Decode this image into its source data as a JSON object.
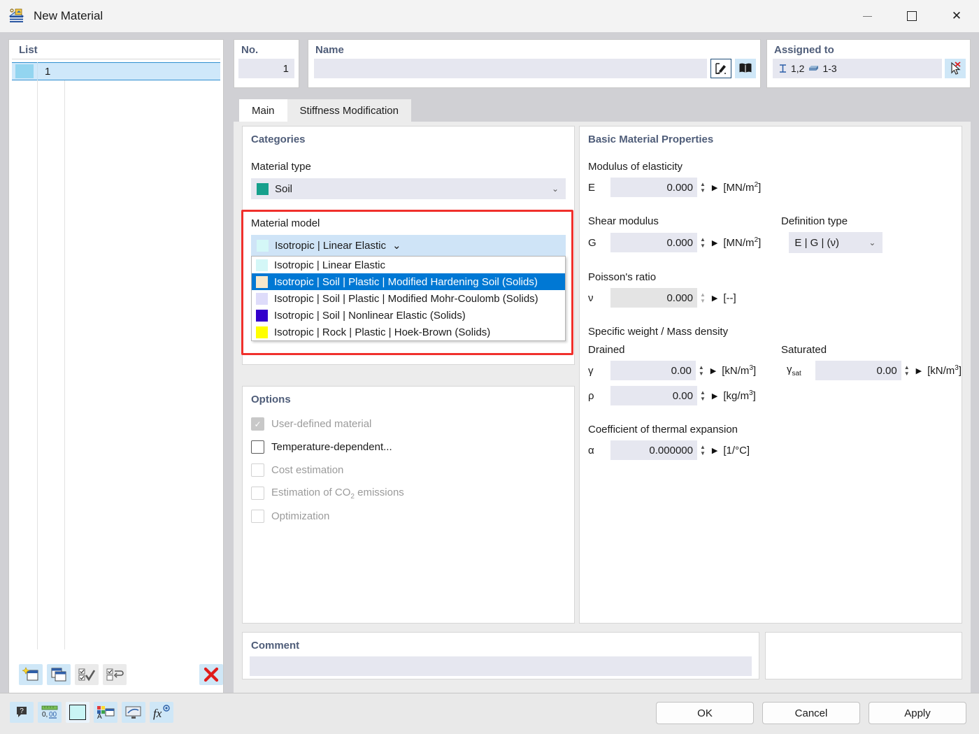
{
  "window": {
    "title": "New Material",
    "icon": "material-icon",
    "minimize": "minimize-icon",
    "maximize": "maximize-icon",
    "close": "close-icon"
  },
  "list": {
    "title": "List",
    "rows": [
      {
        "swatch": "#93d5f0",
        "no": "1",
        "name": ""
      }
    ],
    "toolbar": [
      {
        "name": "new-material-button",
        "icon": "new-window-star-icon"
      },
      {
        "name": "copy-material-button",
        "icon": "copy-window-icon"
      },
      {
        "name": "select-all-button",
        "icon": "check-all-icon"
      },
      {
        "name": "invert-selection-button",
        "icon": "invert-selection-icon"
      },
      {
        "name": "delete-material-button",
        "icon": "red-x-icon"
      }
    ]
  },
  "no": {
    "title": "No.",
    "value": "1"
  },
  "name": {
    "title": "Name",
    "value": "",
    "placeholder": "",
    "edit_icon": "edit-pencil-icon",
    "library_icon": "book-library-icon"
  },
  "assigned": {
    "title": "Assigned to",
    "members_icon": "i-beam-member-icon",
    "members": "1,2",
    "surfaces_icon": "solid-block-icon",
    "surfaces": "1-3",
    "pick_icon": "pick-cursor-icon"
  },
  "tabs": [
    {
      "label": "Main",
      "active": true
    },
    {
      "label": "Stiffness Modification",
      "active": false
    }
  ],
  "categories": {
    "title": "Categories",
    "material_type_label": "Material type",
    "material_type_value": "Soil",
    "material_type_color": "#17a08c",
    "material_model_label": "Material model",
    "material_model_value": "Isotropic | Linear Elastic",
    "material_model_color": "#d4f7f7",
    "material_model_options": [
      {
        "label": "Isotropic | Linear Elastic",
        "color": "#d4f7f7",
        "selected": false
      },
      {
        "label": "Isotropic | Soil | Plastic | Modified Hardening Soil (Solids)",
        "color": "#f7e8cb",
        "selected": true
      },
      {
        "label": "Isotropic | Soil | Plastic | Modified Mohr-Coulomb (Solids)",
        "color": "#dedcfa",
        "selected": false
      },
      {
        "label": "Isotropic | Soil | Nonlinear Elastic (Solids)",
        "color": "#3300cc",
        "selected": false
      },
      {
        "label": "Isotropic | Rock | Plastic | Hoek-Brown (Solids)",
        "color": "#ffff00",
        "selected": false
      }
    ]
  },
  "options": {
    "title": "Options",
    "items": [
      {
        "label": "User-defined material",
        "checked": true,
        "disabled": true
      },
      {
        "label": "Temperature-dependent...",
        "checked": false,
        "disabled": false
      },
      {
        "label": "Cost estimation",
        "checked": false,
        "disabled": true
      },
      {
        "label": "Estimation of CO2 emissions",
        "checked": false,
        "disabled": true
      },
      {
        "label": "Optimization",
        "checked": false,
        "disabled": true
      }
    ]
  },
  "properties": {
    "title": "Basic Material Properties",
    "modulus_group": "Modulus of elasticity",
    "modulus": {
      "symbol": "E",
      "value": "0.000",
      "unit": "MN/m2"
    },
    "shear_group": "Shear modulus",
    "shear": {
      "symbol": "G",
      "value": "0.000",
      "unit": "MN/m2"
    },
    "definition_type_label": "Definition type",
    "definition_type_value": "E | G | (ν)",
    "poisson_group": "Poisson's ratio",
    "poisson": {
      "symbol": "ν",
      "value": "0.000",
      "unit": "[--]"
    },
    "weight_group": "Specific weight / Mass density",
    "drained_label": "Drained",
    "saturated_label": "Saturated",
    "gamma": {
      "symbol": "γ",
      "value": "0.00",
      "unit": "kN/m3"
    },
    "rho": {
      "symbol": "ρ",
      "value": "0.00",
      "unit": "kg/m3"
    },
    "gamma_sat": {
      "symbol": "γsat",
      "value": "0.00",
      "unit": "kN/m3"
    },
    "thermal_group": "Coefficient of thermal expansion",
    "alpha": {
      "symbol": "α",
      "value": "0.000000",
      "unit": "[1/°C]"
    }
  },
  "comment": {
    "title": "Comment",
    "value": ""
  },
  "status_toolbar": [
    {
      "name": "help-button",
      "icon": "help-bubble-icon"
    },
    {
      "name": "decimal-places-button",
      "icon": "decimal-ruler-icon"
    },
    {
      "name": "color-button",
      "icon": "color-swatch-icon"
    },
    {
      "name": "display-properties-button",
      "icon": "display-properties-icon"
    },
    {
      "name": "view-settings-button",
      "icon": "monitor-icon"
    },
    {
      "name": "formula-button",
      "icon": "fx-icon"
    }
  ],
  "dialog_buttons": {
    "ok": "OK",
    "cancel": "Cancel",
    "apply": "Apply"
  }
}
